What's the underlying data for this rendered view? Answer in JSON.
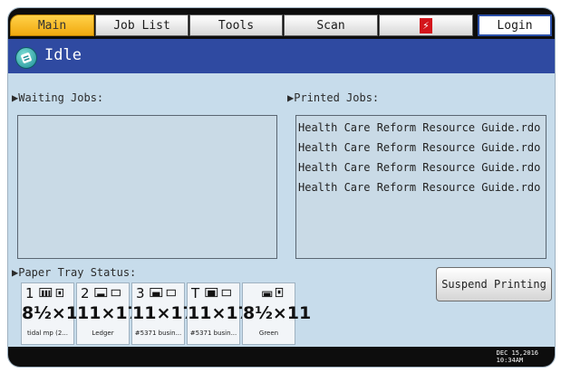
{
  "tabs": {
    "main": "Main",
    "job_list": "Job List",
    "tools": "Tools",
    "scan": "Scan",
    "fiery_icon": "fiery-logo",
    "login": "Login"
  },
  "status": {
    "text": "Idle"
  },
  "sections": {
    "waiting_label": "▶Waiting Jobs:",
    "printed_label": "▶Printed Jobs:",
    "tray_label": "▶Paper Tray Status:"
  },
  "printed_jobs": [
    "Health Care Reform Resource Guide.rdo",
    "Health Care Reform Resource Guide.rdo",
    "Health Care Reform Resource Guide.rdo",
    "Health Care Reform Resource Guide.rdo"
  ],
  "suspend_button": "Suspend Printing",
  "trays": [
    {
      "number": "1",
      "size": "8½×11",
      "type": "tidal mp (2..."
    },
    {
      "number": "2",
      "size": "11×17",
      "type": "Ledger"
    },
    {
      "number": "3",
      "size": "11×17",
      "type": "#5371 busin..."
    },
    {
      "number": "T",
      "size": "11×17",
      "type": "#5371 busin..."
    },
    {
      "number": "",
      "size": "8½×11",
      "type": "Green"
    }
  ],
  "datetime": {
    "date": "DEC  15,2016",
    "time": "10:34AM"
  },
  "colors": {
    "main_tab": "#f1a90e",
    "status_bar": "#2f4aa1",
    "background": "#c7dceb"
  }
}
